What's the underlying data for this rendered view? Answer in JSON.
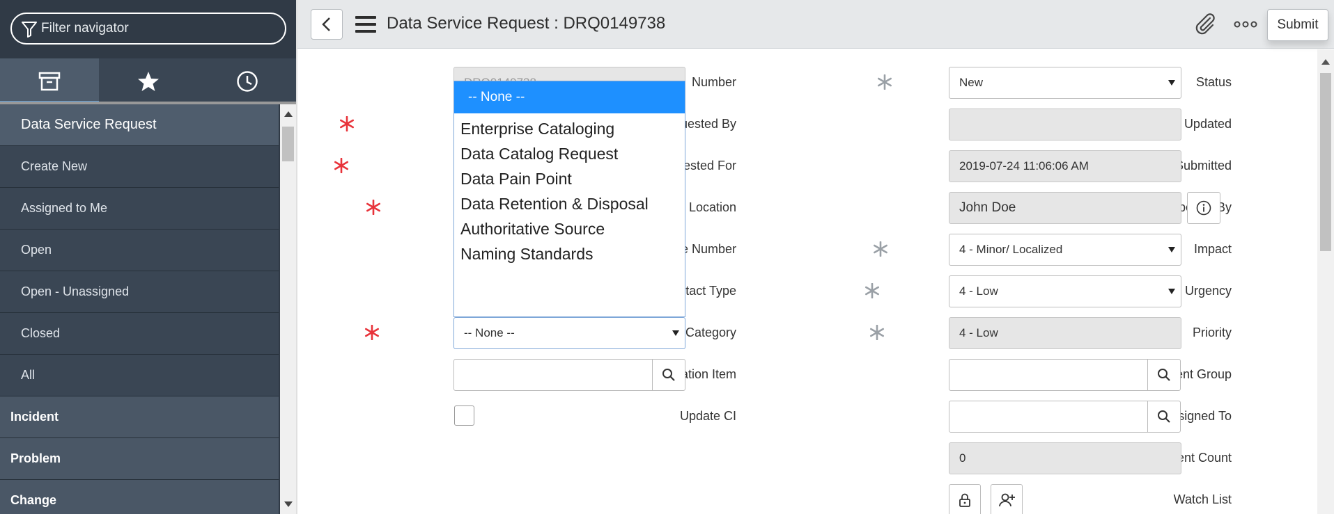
{
  "navigator": {
    "filter_placeholder": "Filter navigator",
    "tabs": [
      {
        "name": "all-applications",
        "icon": "archive-icon"
      },
      {
        "name": "favorites",
        "icon": "star-icon"
      },
      {
        "name": "history",
        "icon": "clock-icon"
      }
    ],
    "module_header": "Data Service Request",
    "modules": [
      "Create New",
      "Assigned to Me",
      "Open",
      "Open - Unassigned",
      "Closed",
      "All"
    ],
    "apps": [
      "Incident",
      "Problem",
      "Change"
    ]
  },
  "header": {
    "title": "Data Service Request : DRQ0149738",
    "submit_label": "Submit"
  },
  "form": {
    "left": {
      "number": {
        "label": "Number",
        "value": "DRQ0149738"
      },
      "requested_by": {
        "label": "Requested By"
      },
      "requested_for": {
        "label": "Requested For"
      },
      "location": {
        "label": "Location"
      },
      "phone_number": {
        "label": "Phone Number"
      },
      "contact_type": {
        "label": "Contact Type"
      },
      "category": {
        "label": "Category",
        "value": "-- None --"
      },
      "configuration_item": {
        "label": "Configuration Item"
      },
      "update_ci": {
        "label": "Update CI"
      }
    },
    "right": {
      "status": {
        "label": "Status",
        "value": "New"
      },
      "updated": {
        "label": "Updated",
        "value": ""
      },
      "date_submitted": {
        "label": "Date Submitted",
        "value": "2019-07-24 11:06:06 AM"
      },
      "opened_by": {
        "label": "Opened By",
        "value": "John Doe"
      },
      "impact": {
        "label": "Impact",
        "value": "4 - Minor/ Localized"
      },
      "urgency": {
        "label": "Urgency",
        "value": "4 - Low"
      },
      "priority": {
        "label": "Priority",
        "value": "4 - Low"
      },
      "assignment_group": {
        "label": "Assignment Group"
      },
      "assigned_to": {
        "label": "Assigned To"
      },
      "reassignment_count": {
        "label": "Reassignment Count",
        "value": "0"
      },
      "watch_list": {
        "label": "Watch List"
      }
    }
  },
  "category_dropdown": {
    "options": [
      "-- None --",
      "Enterprise Cataloging",
      "Data Catalog Request",
      "Data Pain Point",
      "Data Retention & Disposal",
      "Authoritative Source",
      "Naming Standards"
    ],
    "selected_index": 0
  },
  "colors": {
    "sidebar_bg": "#303a46",
    "header_bg": "#e6e8ea",
    "required_red": "#e8333a",
    "required_gray": "#9aa0a6",
    "selected_blue": "#1e90ff",
    "active_tab_underline": "#5b9bd5"
  }
}
